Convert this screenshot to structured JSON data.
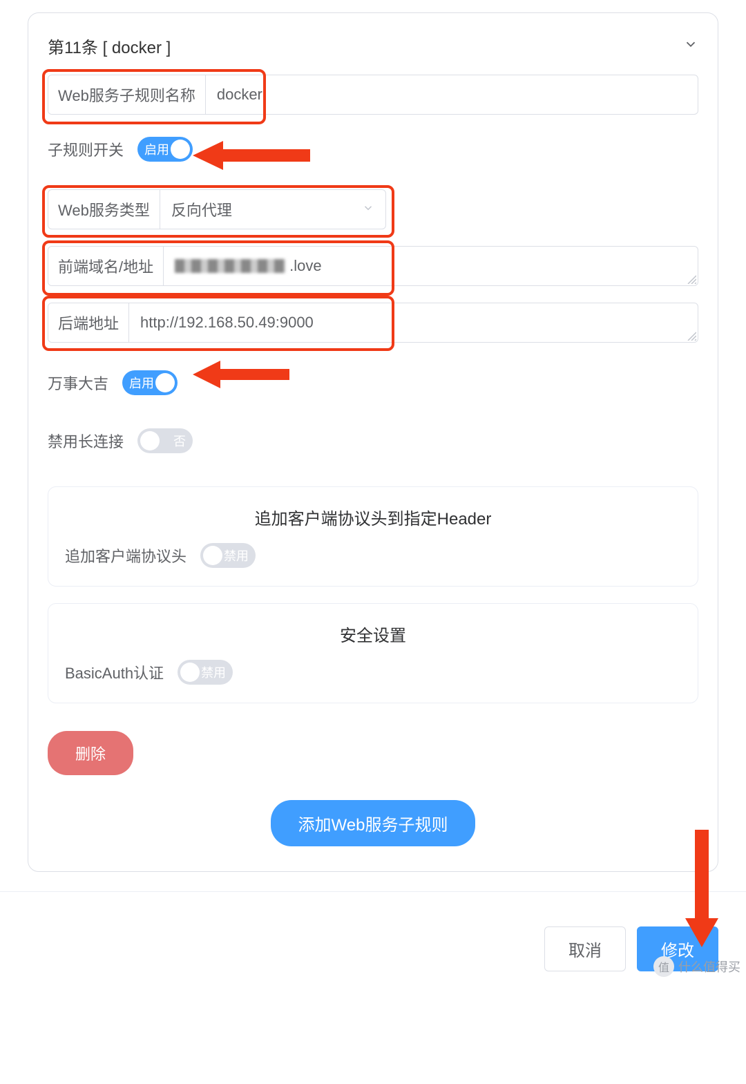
{
  "rule": {
    "header_title": "第11条 [ docker ]",
    "name_label": "Web服务子规则名称",
    "name_value": "docker",
    "switch_label": "子规则开关",
    "switch_state_text": "启用",
    "type_label": "Web服务类型",
    "type_value": "反向代理",
    "frontend_label": "前端域名/地址",
    "frontend_value_suffix": ".love",
    "backend_label": "后端地址",
    "backend_value": "http://192.168.50.49:9000",
    "luck_label": "万事大吉",
    "luck_state_text": "启用",
    "long_conn_label": "禁用长连接",
    "long_conn_state_text": "否",
    "header_card": {
      "title": "追加客户端协议头到指定Header",
      "row_label": "追加客户端协议头",
      "row_state_text": "禁用"
    },
    "security_card": {
      "title": "安全设置",
      "row_label": "BasicAuth认证",
      "row_state_text": "禁用"
    },
    "delete_btn": "删除"
  },
  "add_rule_btn": "添加Web服务子规则",
  "footer": {
    "cancel": "取消",
    "confirm": "修改"
  },
  "watermark": {
    "circle": "值",
    "text": "什么值得买"
  }
}
